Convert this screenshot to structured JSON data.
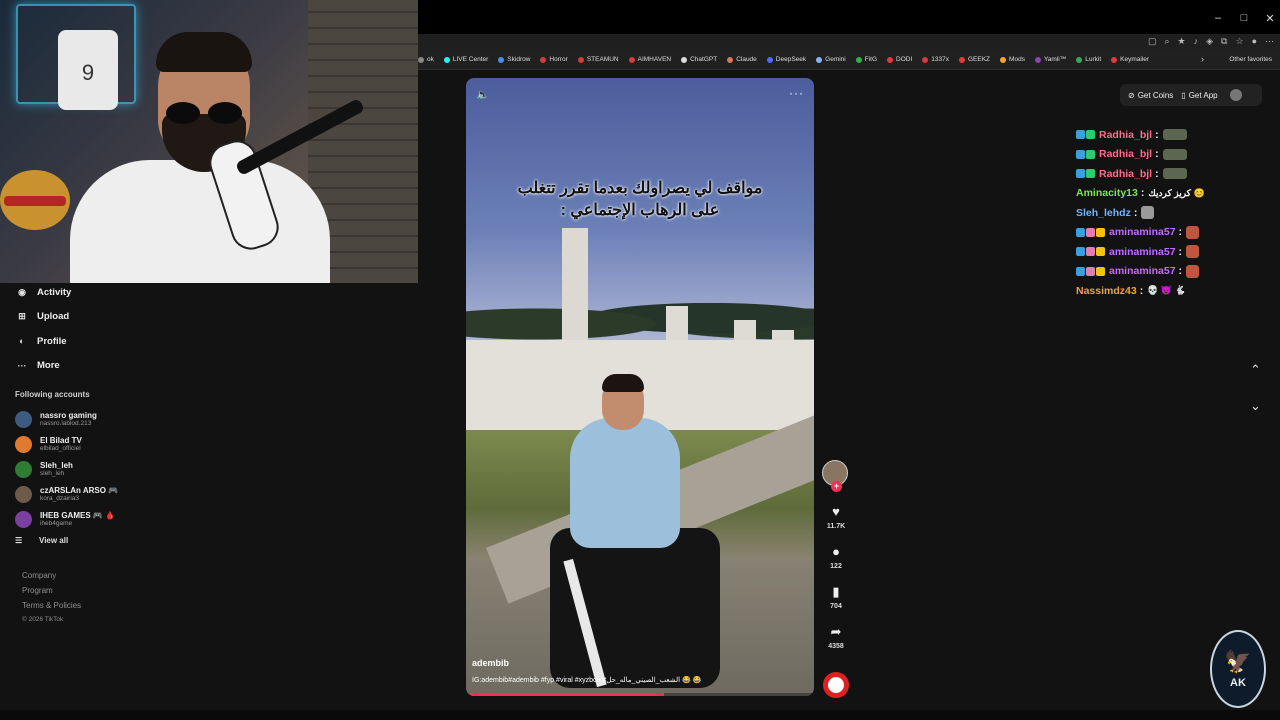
{
  "window": {
    "controls": [
      "–",
      "□",
      "✕"
    ]
  },
  "bookmarks": {
    "items": [
      {
        "label": "ok",
        "color": "#888888"
      },
      {
        "label": "LIVE Center",
        "color": "#25f4ee"
      },
      {
        "label": "Skidrow",
        "color": "#4a8fe7"
      },
      {
        "label": "Horror",
        "color": "#d23c3c"
      },
      {
        "label": "STEAMUN",
        "color": "#d23c3c"
      },
      {
        "label": "AIMHAVEN",
        "color": "#d23c3c"
      },
      {
        "label": "ChatGPT",
        "color": "#dddddd"
      },
      {
        "label": "Claude",
        "color": "#d97757"
      },
      {
        "label": "DeepSeek",
        "color": "#4d6bfe"
      },
      {
        "label": "Gemini",
        "color": "#8ab4f8"
      },
      {
        "label": "FitG",
        "color": "#2fb34a"
      },
      {
        "label": "DODI",
        "color": "#e53935"
      },
      {
        "label": "1337x",
        "color": "#d23c3c"
      },
      {
        "label": "GEEKZ",
        "color": "#e53935"
      },
      {
        "label": "Mods",
        "color": "#f5a623"
      },
      {
        "label": "Yamli™",
        "color": "#8e44ad"
      },
      {
        "label": "Lurkit",
        "color": "#3ba55c"
      },
      {
        "label": "Keymailer",
        "color": "#e53935"
      }
    ],
    "other": "Other favorites"
  },
  "sidebar": {
    "nav": [
      {
        "label": "Activity",
        "icon": "bell-icon",
        "glyph": "◉"
      },
      {
        "label": "Upload",
        "icon": "upload-icon",
        "glyph": "⊞"
      },
      {
        "label": "Profile",
        "icon": "profile-icon",
        "glyph": "◐"
      },
      {
        "label": "More",
        "icon": "more-icon",
        "glyph": "···"
      }
    ],
    "following_title": "Following accounts",
    "accounts": [
      {
        "name": "nassro gaming",
        "handle": "nassro.lablod.213",
        "color": "#3d5a80"
      },
      {
        "name": "El Bilad TV",
        "handle": "elbilad_officiel",
        "color": "#e07a2f"
      },
      {
        "name": "Sleh_leh",
        "handle": "sleh_leh",
        "color": "#2e7d32"
      },
      {
        "name": "czARSLAn ARSO 🎮",
        "handle": "kora_dzairia3",
        "color": "#6d5a4a"
      },
      {
        "name": "IHEB GAMES 🎮 🩸",
        "handle": "iheb4game",
        "color": "#7b3fa0"
      }
    ],
    "view_all": "View all",
    "footer": [
      "Company",
      "Program",
      "Terms & Policies"
    ],
    "copyright": "© 2026 TikTok"
  },
  "video": {
    "caption_line1": "مواقف لي يصراولك بعدما تقرر تتغلب",
    "caption_line2": "على الرهاب الإجتماعي :",
    "author": "adembib",
    "description": "IG:adembib#adembib #fyp #viral #xyzbca #الشعب_الصيني_ماله_حل 😂 😂",
    "progress": 0.57
  },
  "rail": {
    "likes": "11.7K",
    "comments": "122",
    "saves": "704",
    "shares": "4358"
  },
  "top_actions": {
    "coins": "Get Coins",
    "app": "Get App"
  },
  "chat": [
    {
      "user": "Radhia_bjl",
      "color": "#ff6b8b",
      "badges": [
        "#39a0e0",
        "#2ecc71"
      ],
      "emote": "#5d6650"
    },
    {
      "user": "Radhia_bjl",
      "color": "#ff6b8b",
      "badges": [
        "#39a0e0",
        "#2ecc71"
      ],
      "emote": "#5d6650"
    },
    {
      "user": "Radhia_bjl",
      "color": "#ff6b8b",
      "badges": [
        "#39a0e0",
        "#2ecc71"
      ],
      "emote": "#5d6650"
    },
    {
      "user": "Aminacity13",
      "color": "#7ee35b",
      "badges": [],
      "message": "كريز كرديك 😊"
    },
    {
      "user": "Sleh_lehdz",
      "color": "#6fb3ff",
      "badges": [],
      "emote": "#9a9a9a",
      "emote_square": true
    },
    {
      "user": "aminamina57",
      "color": "#c46cff",
      "badges": [
        "#39a0e0",
        "#e27fb0",
        "#f1c40f"
      ],
      "emote": "#c0563f",
      "emote_square": true
    },
    {
      "user": "aminamina57",
      "color": "#c46cff",
      "badges": [
        "#39a0e0",
        "#e27fb0",
        "#f1c40f"
      ],
      "emote": "#c0563f",
      "emote_square": true
    },
    {
      "user": "aminamina57",
      "color": "#c46cff",
      "badges": [
        "#39a0e0",
        "#e27fb0",
        "#f1c40f"
      ],
      "emote": "#c0563f",
      "emote_square": true
    },
    {
      "user": "Nassimdz43",
      "color": "#f0a33a",
      "badges": [],
      "message": "💀 😈 🐇"
    }
  ],
  "logo": {
    "text": "AK"
  }
}
